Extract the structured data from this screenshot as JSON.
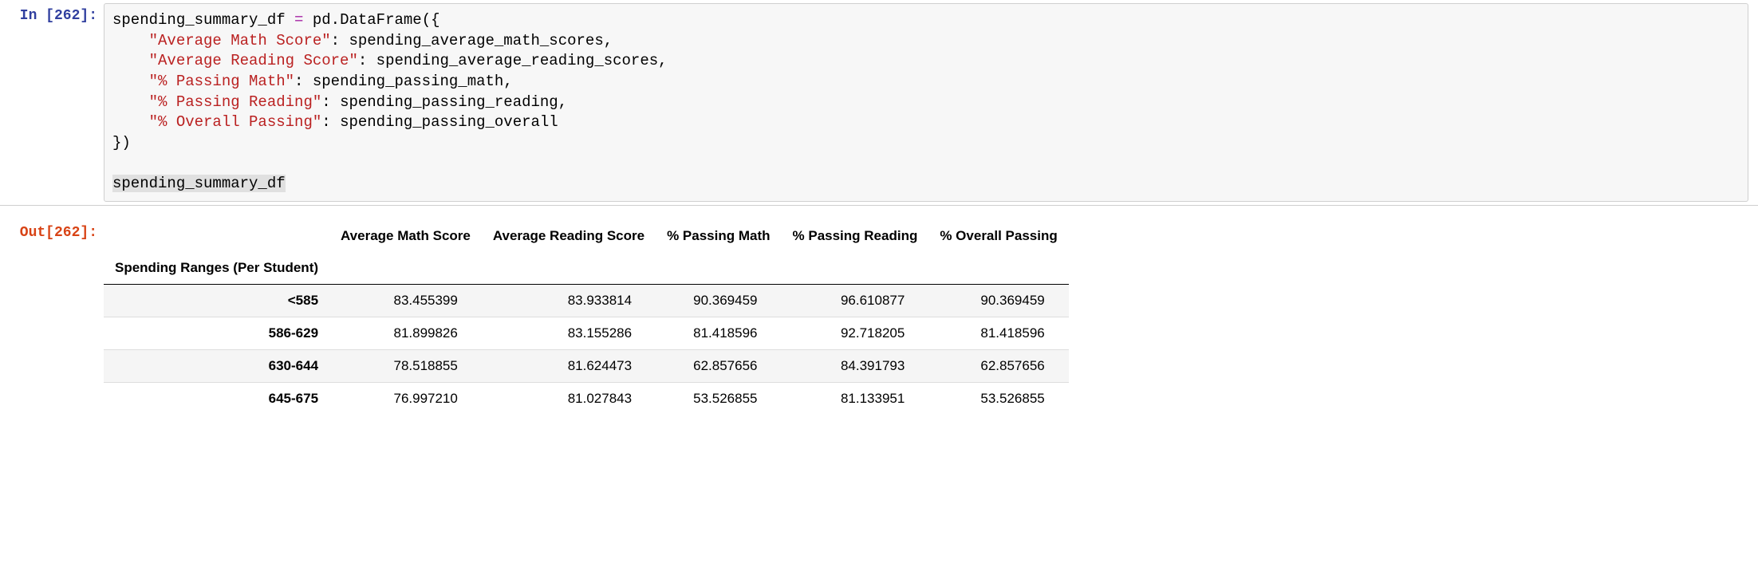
{
  "cell": {
    "in_prompt_prefix": "In ",
    "in_prompt_open": "[",
    "in_prompt_num": "262",
    "in_prompt_close": "]:",
    "out_prompt_prefix": "Out",
    "out_prompt_open": "[",
    "out_prompt_num": "262",
    "out_prompt_close": "]:"
  },
  "code": {
    "var1": "spending_summary_df",
    "op_eq": " = ",
    "call1": "pd.DataFrame",
    "open": "({",
    "k1": "\"Average Math Score\"",
    "sep": ": ",
    "v1": "spending_average_math_scores",
    "comma": ",",
    "k2": "\"Average Reading Score\"",
    "v2": "spending_average_reading_scores",
    "k3": "\"% Passing Math\"",
    "v3": "spending_passing_math",
    "k4": "\"% Passing Reading\"",
    "v4": "spending_passing_reading",
    "k5": "\"% Overall Passing\"",
    "v5": "spending_passing_overall",
    "close": "})",
    "last": "spending_summary_df"
  },
  "table": {
    "index_name": "Spending Ranges (Per Student)",
    "columns": [
      "Average Math Score",
      "Average Reading Score",
      "% Passing Math",
      "% Passing Reading",
      "% Overall Passing"
    ],
    "rows": [
      {
        "idx": "<585",
        "cells": [
          "83.455399",
          "83.933814",
          "90.369459",
          "96.610877",
          "90.369459"
        ]
      },
      {
        "idx": "586-629",
        "cells": [
          "81.899826",
          "83.155286",
          "81.418596",
          "92.718205",
          "81.418596"
        ]
      },
      {
        "idx": "630-644",
        "cells": [
          "78.518855",
          "81.624473",
          "62.857656",
          "84.391793",
          "62.857656"
        ]
      },
      {
        "idx": "645-675",
        "cells": [
          "76.997210",
          "81.027843",
          "53.526855",
          "81.133951",
          "53.526855"
        ]
      }
    ]
  }
}
